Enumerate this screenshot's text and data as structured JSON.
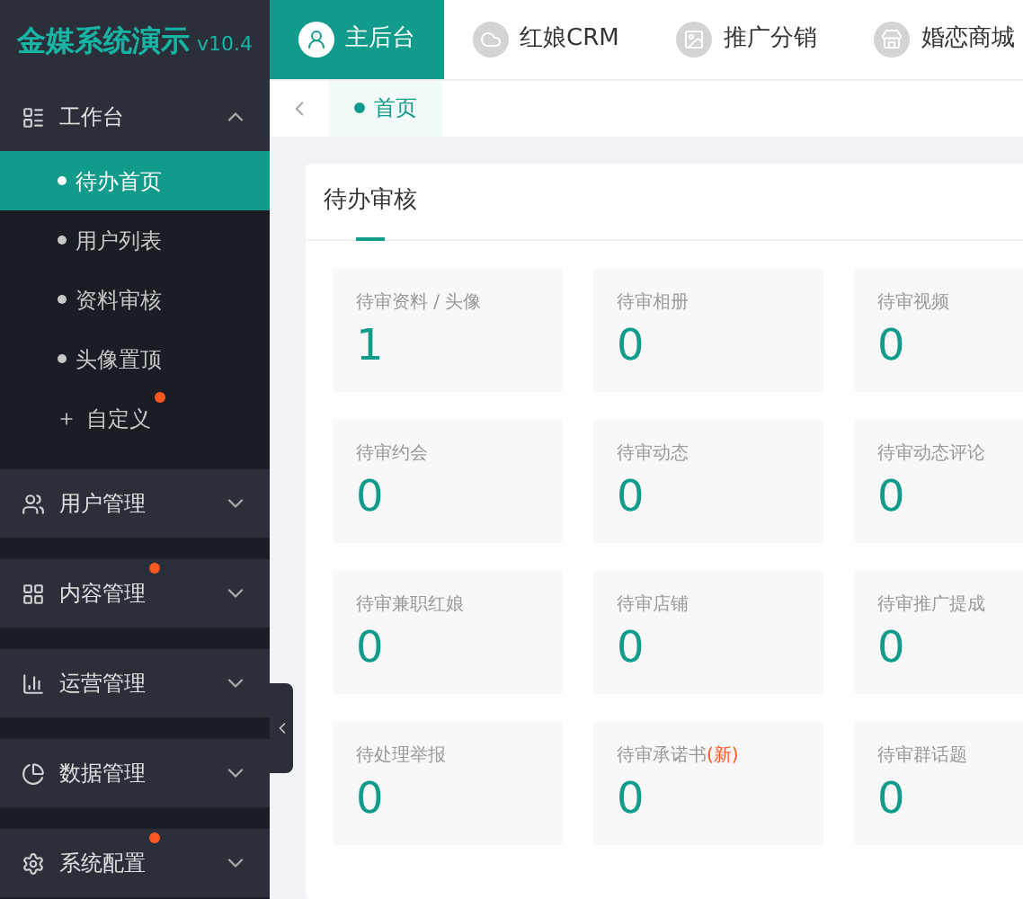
{
  "app": {
    "title": "金媒系统演示",
    "version": "v10.4"
  },
  "top_tabs": [
    {
      "label": "主后台",
      "selected": true
    },
    {
      "label": "红娘CRM",
      "selected": false
    },
    {
      "label": "推广分销",
      "selected": false
    },
    {
      "label": "婚恋商城",
      "selected": false
    }
  ],
  "breadcrumb": [
    {
      "label": "首页",
      "selected": true
    }
  ],
  "sidebar": [
    {
      "label": "工作台",
      "expanded": true,
      "dot": false,
      "children": [
        {
          "label": "待办首页",
          "kind": "bullet",
          "selected": true,
          "dot": false
        },
        {
          "label": "用户列表",
          "kind": "bullet",
          "selected": false,
          "dot": false
        },
        {
          "label": "资料审核",
          "kind": "bullet",
          "selected": false,
          "dot": false
        },
        {
          "label": "头像置顶",
          "kind": "bullet",
          "selected": false,
          "dot": false
        },
        {
          "label": "自定义",
          "kind": "plus",
          "selected": false,
          "dot": true
        }
      ]
    },
    {
      "label": "用户管理",
      "expanded": false,
      "dot": false
    },
    {
      "label": "内容管理",
      "expanded": false,
      "dot": true
    },
    {
      "label": "运营管理",
      "expanded": false,
      "dot": false
    },
    {
      "label": "数据管理",
      "expanded": false,
      "dot": false
    },
    {
      "label": "系统配置",
      "expanded": false,
      "dot": true
    }
  ],
  "panel": {
    "title": "待办审核",
    "cards": [
      {
        "label": "待审资料 / 头像",
        "value": "1"
      },
      {
        "label": "待审相册",
        "value": "0"
      },
      {
        "label": "待审视频",
        "value": "0"
      },
      {
        "label": "待审约会",
        "value": "0"
      },
      {
        "label": "待审动态",
        "value": "0"
      },
      {
        "label": "待审动态评论",
        "value": "0"
      },
      {
        "label": "待审兼职红娘",
        "value": "0"
      },
      {
        "label": "待审店铺",
        "value": "0"
      },
      {
        "label": "待审推广提成",
        "value": "0"
      },
      {
        "label": "待处理举报",
        "value": "0"
      },
      {
        "label": "待审承诺书",
        "tag": "(新)",
        "value": "0"
      },
      {
        "label": "待审群话题",
        "value": "0"
      }
    ]
  }
}
